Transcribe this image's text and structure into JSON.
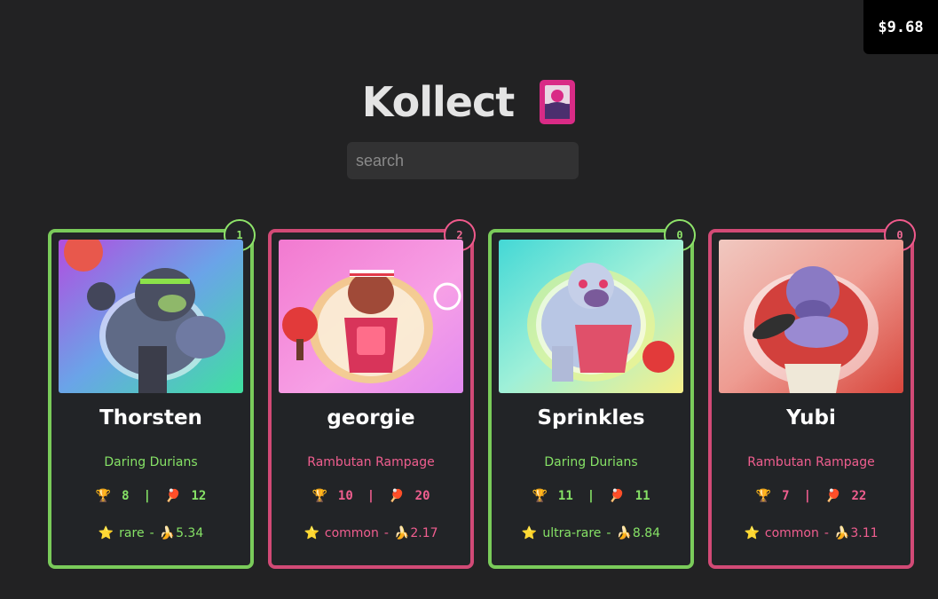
{
  "balance": "$9.68",
  "app": {
    "title": "Kollect",
    "logo_icon": "card-icon"
  },
  "search": {
    "placeholder": "search",
    "value": ""
  },
  "cards": [
    {
      "rank": "1",
      "name": "Thorsten",
      "team": "Daring Durians",
      "trophies": "8",
      "paddles": "12",
      "rarity": "rare",
      "price": "5.34",
      "theme": "green",
      "image": "gorilla-figure-purple-green"
    },
    {
      "rank": "2",
      "name": "georgie",
      "team": "Rambutan Rampage",
      "trophies": "10",
      "paddles": "20",
      "rarity": "common",
      "price": "2.17",
      "theme": "pink",
      "image": "monkey-figure-headband-pink"
    },
    {
      "rank": "0",
      "name": "Sprinkles",
      "team": "Daring Durians",
      "trophies": "11",
      "paddles": "11",
      "rarity": "ultra-rare",
      "price": "8.84",
      "theme": "green",
      "image": "yeti-figure-teal"
    },
    {
      "rank": "0",
      "name": "Yubi",
      "team": "Rambutan Rampage",
      "trophies": "7",
      "paddles": "22",
      "rarity": "common",
      "price": "3.11",
      "theme": "pink",
      "image": "orangutan-figure-red"
    }
  ],
  "colors": {
    "background": "#222223",
    "green_theme": "#7acb5a",
    "pink_theme": "#d24a76"
  },
  "separators": {
    "stat": "|",
    "meta": "-"
  }
}
